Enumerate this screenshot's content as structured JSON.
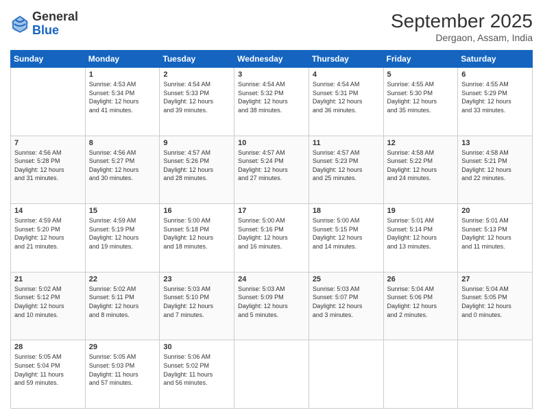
{
  "header": {
    "logo_line1": "General",
    "logo_line2": "Blue",
    "month": "September 2025",
    "location": "Dergaon, Assam, India"
  },
  "weekdays": [
    "Sunday",
    "Monday",
    "Tuesday",
    "Wednesday",
    "Thursday",
    "Friday",
    "Saturday"
  ],
  "weeks": [
    [
      {
        "day": "",
        "info": ""
      },
      {
        "day": "1",
        "info": "Sunrise: 4:53 AM\nSunset: 5:34 PM\nDaylight: 12 hours\nand 41 minutes."
      },
      {
        "day": "2",
        "info": "Sunrise: 4:54 AM\nSunset: 5:33 PM\nDaylight: 12 hours\nand 39 minutes."
      },
      {
        "day": "3",
        "info": "Sunrise: 4:54 AM\nSunset: 5:32 PM\nDaylight: 12 hours\nand 38 minutes."
      },
      {
        "day": "4",
        "info": "Sunrise: 4:54 AM\nSunset: 5:31 PM\nDaylight: 12 hours\nand 36 minutes."
      },
      {
        "day": "5",
        "info": "Sunrise: 4:55 AM\nSunset: 5:30 PM\nDaylight: 12 hours\nand 35 minutes."
      },
      {
        "day": "6",
        "info": "Sunrise: 4:55 AM\nSunset: 5:29 PM\nDaylight: 12 hours\nand 33 minutes."
      }
    ],
    [
      {
        "day": "7",
        "info": "Sunrise: 4:56 AM\nSunset: 5:28 PM\nDaylight: 12 hours\nand 31 minutes."
      },
      {
        "day": "8",
        "info": "Sunrise: 4:56 AM\nSunset: 5:27 PM\nDaylight: 12 hours\nand 30 minutes."
      },
      {
        "day": "9",
        "info": "Sunrise: 4:57 AM\nSunset: 5:26 PM\nDaylight: 12 hours\nand 28 minutes."
      },
      {
        "day": "10",
        "info": "Sunrise: 4:57 AM\nSunset: 5:24 PM\nDaylight: 12 hours\nand 27 minutes."
      },
      {
        "day": "11",
        "info": "Sunrise: 4:57 AM\nSunset: 5:23 PM\nDaylight: 12 hours\nand 25 minutes."
      },
      {
        "day": "12",
        "info": "Sunrise: 4:58 AM\nSunset: 5:22 PM\nDaylight: 12 hours\nand 24 minutes."
      },
      {
        "day": "13",
        "info": "Sunrise: 4:58 AM\nSunset: 5:21 PM\nDaylight: 12 hours\nand 22 minutes."
      }
    ],
    [
      {
        "day": "14",
        "info": "Sunrise: 4:59 AM\nSunset: 5:20 PM\nDaylight: 12 hours\nand 21 minutes."
      },
      {
        "day": "15",
        "info": "Sunrise: 4:59 AM\nSunset: 5:19 PM\nDaylight: 12 hours\nand 19 minutes."
      },
      {
        "day": "16",
        "info": "Sunrise: 5:00 AM\nSunset: 5:18 PM\nDaylight: 12 hours\nand 18 minutes."
      },
      {
        "day": "17",
        "info": "Sunrise: 5:00 AM\nSunset: 5:16 PM\nDaylight: 12 hours\nand 16 minutes."
      },
      {
        "day": "18",
        "info": "Sunrise: 5:00 AM\nSunset: 5:15 PM\nDaylight: 12 hours\nand 14 minutes."
      },
      {
        "day": "19",
        "info": "Sunrise: 5:01 AM\nSunset: 5:14 PM\nDaylight: 12 hours\nand 13 minutes."
      },
      {
        "day": "20",
        "info": "Sunrise: 5:01 AM\nSunset: 5:13 PM\nDaylight: 12 hours\nand 11 minutes."
      }
    ],
    [
      {
        "day": "21",
        "info": "Sunrise: 5:02 AM\nSunset: 5:12 PM\nDaylight: 12 hours\nand 10 minutes."
      },
      {
        "day": "22",
        "info": "Sunrise: 5:02 AM\nSunset: 5:11 PM\nDaylight: 12 hours\nand 8 minutes."
      },
      {
        "day": "23",
        "info": "Sunrise: 5:03 AM\nSunset: 5:10 PM\nDaylight: 12 hours\nand 7 minutes."
      },
      {
        "day": "24",
        "info": "Sunrise: 5:03 AM\nSunset: 5:09 PM\nDaylight: 12 hours\nand 5 minutes."
      },
      {
        "day": "25",
        "info": "Sunrise: 5:03 AM\nSunset: 5:07 PM\nDaylight: 12 hours\nand 3 minutes."
      },
      {
        "day": "26",
        "info": "Sunrise: 5:04 AM\nSunset: 5:06 PM\nDaylight: 12 hours\nand 2 minutes."
      },
      {
        "day": "27",
        "info": "Sunrise: 5:04 AM\nSunset: 5:05 PM\nDaylight: 12 hours\nand 0 minutes."
      }
    ],
    [
      {
        "day": "28",
        "info": "Sunrise: 5:05 AM\nSunset: 5:04 PM\nDaylight: 11 hours\nand 59 minutes."
      },
      {
        "day": "29",
        "info": "Sunrise: 5:05 AM\nSunset: 5:03 PM\nDaylight: 11 hours\nand 57 minutes."
      },
      {
        "day": "30",
        "info": "Sunrise: 5:06 AM\nSunset: 5:02 PM\nDaylight: 11 hours\nand 56 minutes."
      },
      {
        "day": "",
        "info": ""
      },
      {
        "day": "",
        "info": ""
      },
      {
        "day": "",
        "info": ""
      },
      {
        "day": "",
        "info": ""
      }
    ]
  ]
}
